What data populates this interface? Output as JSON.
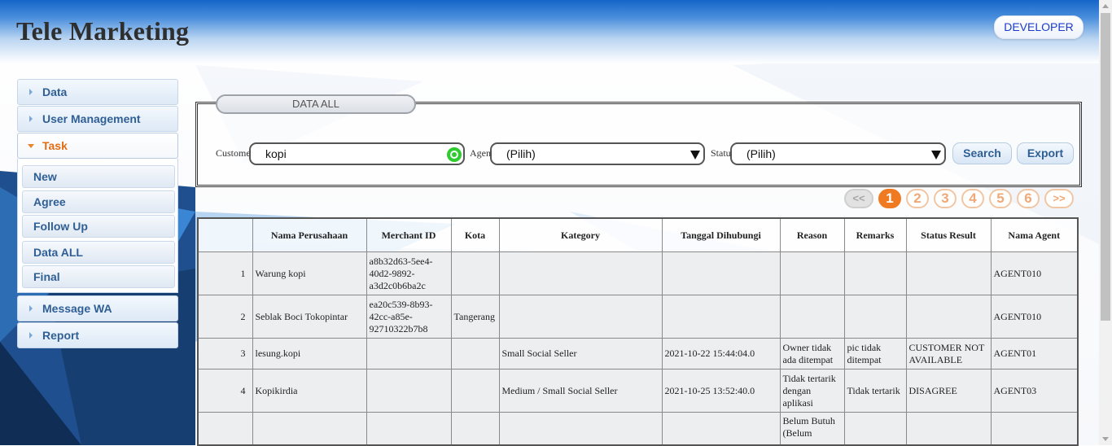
{
  "app": {
    "title": "Tele Marketing",
    "user_button": "DEVELOPER"
  },
  "sidebar": {
    "items": [
      {
        "label": "Data"
      },
      {
        "label": "User Management"
      },
      {
        "label": "Task"
      },
      {
        "label": "Message WA"
      },
      {
        "label": "Report"
      }
    ],
    "task_submenu": [
      {
        "label": "New"
      },
      {
        "label": "Agree"
      },
      {
        "label": "Follow Up"
      },
      {
        "label": "Data ALL"
      },
      {
        "label": "Final"
      }
    ]
  },
  "filters": {
    "legend": "DATA ALL",
    "customer_label": "Customer",
    "customer_value": "kopi",
    "agent_label": "Agent",
    "agent_value": "(Pilih)",
    "status_label": "Status",
    "status_value": "(Pilih)",
    "search_button": "Search",
    "export_button": "Export"
  },
  "pagination": {
    "prev": "<<",
    "pages": [
      "1",
      "2",
      "3",
      "4",
      "5",
      "6"
    ],
    "next": ">>",
    "current": "1"
  },
  "table": {
    "columns": [
      "",
      "Nama Perusahaan",
      "Merchant ID",
      "Kota",
      "Kategory",
      "Tanggal Dihubungi",
      "Reason",
      "Remarks",
      "Status Result",
      "Nama Agent"
    ],
    "rows": [
      [
        "1",
        "Warung kopi",
        "a8b32d63-5ee4-40d2-9892-a3d2c0b6ba2c",
        "",
        "",
        "",
        "",
        "",
        "",
        "AGENT010"
      ],
      [
        "2",
        "Seblak Boci Tokopintar",
        "ea20c539-8b93-42cc-a85e-92710322b7b8",
        "Tangerang",
        "",
        "",
        "",
        "",
        "",
        "AGENT010"
      ],
      [
        "3",
        "lesung.kopi",
        "",
        "",
        "Small Social Seller",
        "2021-10-22 15:44:04.0",
        "Owner tidak ada ditempat",
        "pic tidak ditempat",
        "CUSTOMER NOT AVAILABLE",
        "AGENT01"
      ],
      [
        "4",
        "Kopikirdia",
        "",
        "",
        "Medium / Small Social Seller",
        "2021-10-25 13:52:40.0",
        "Tidak tertarik dengan aplikasi",
        "Tidak tertarik",
        "DISAGREE",
        "AGENT03"
      ],
      [
        "",
        "",
        "",
        "",
        "",
        "",
        "Belum Butuh (Belum",
        "",
        "",
        ""
      ]
    ]
  },
  "colors": {
    "accent": "#f07a22",
    "header_blue": "#1565c8",
    "menu_text": "#2f5f95",
    "active_menu": "#e06d14"
  }
}
